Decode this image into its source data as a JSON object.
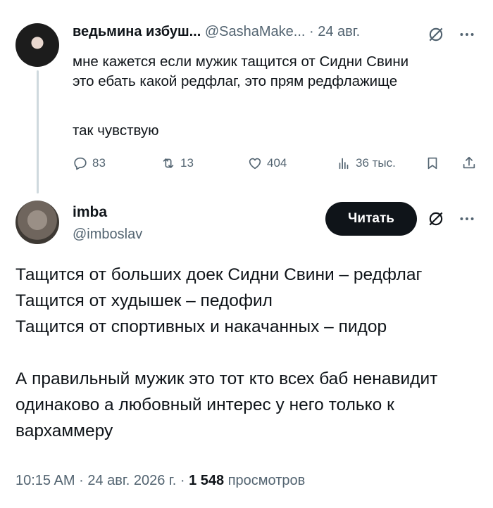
{
  "tweet1": {
    "author_name": "ведьмина избуш...",
    "author_handle": "@SashaMake...",
    "separator": "·",
    "date": "24 авг.",
    "text_line1": "мне кажется если мужик тащится от Сидни Свини",
    "text_line2": "это ебать какой редфлаг, это прям редфлажище",
    "text_line3": "так чувствую",
    "replies": "83",
    "reposts": "13",
    "likes": "404",
    "views": "36 тыс."
  },
  "tweet2": {
    "author_name": "imba",
    "author_handle": "@imboslav",
    "follow_label": "Читать",
    "lines": [
      "Тащится от больших доек Сидни Свини – редфлаг",
      "Тащится от худышек – педофил",
      "Тащится от спортивных и накачанных – пидор",
      "А правильный мужик это тот кто всех баб ненавидит",
      "одинаково а любовный интерес у него только к",
      "вархаммеру"
    ],
    "time": "10:15 AM",
    "sep": "·",
    "date": "24 авг. 2026 г.",
    "views_count": "1 548",
    "views_label": "просмотров"
  },
  "icons": {
    "reply": "reply-icon",
    "repost": "repost-icon",
    "like": "heart-icon",
    "views": "views-chart-icon",
    "bookmark": "bookmark-icon",
    "share": "share-icon",
    "grok": "grok-icon",
    "more": "more-icon"
  },
  "colors": {
    "text": "#0f1419",
    "muted": "#536471",
    "thread_line": "#cfd9de",
    "button_bg": "#0f1419"
  }
}
